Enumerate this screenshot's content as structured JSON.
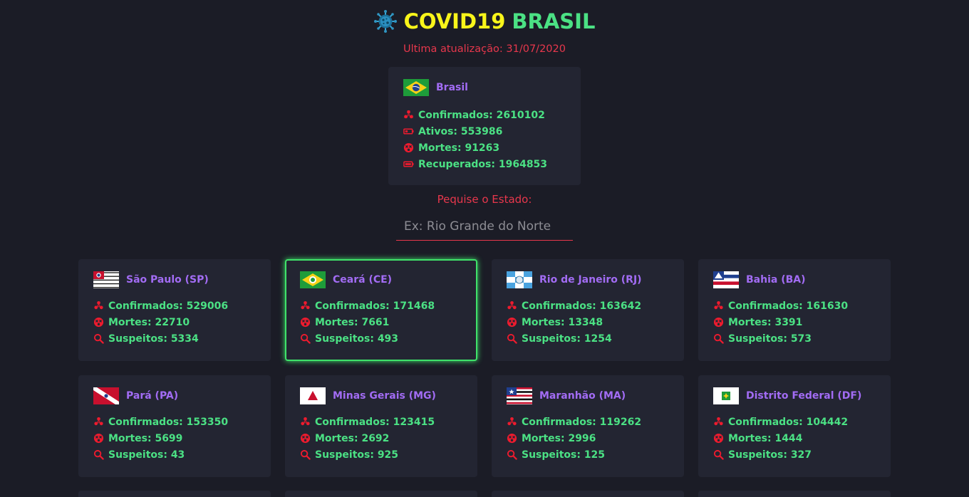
{
  "header": {
    "title_part1": "COVID19",
    "title_part2": "BRASIL",
    "virus_icon": "virus-icon"
  },
  "updated": "Ultima atualização: 31/07/2020",
  "national": {
    "name": "Brasil",
    "confirmed": "Confirmados: 2610102",
    "active": "Ativos: 553986",
    "deaths": "Mortes: 91263",
    "recovered": "Recuperados: 1964853"
  },
  "search": {
    "label": "Pequise o Estado:",
    "placeholder": "Ex: Rio Grande do Norte",
    "value": ""
  },
  "states": [
    {
      "name": "São Paulo (SP)",
      "confirmed": "Confirmados: 529006",
      "deaths": "Mortes: 22710",
      "suspects": "Suspeitos: 5334",
      "selected": false
    },
    {
      "name": "Ceará (CE)",
      "confirmed": "Confirmados: 171468",
      "deaths": "Mortes: 7661",
      "suspects": "Suspeitos: 493",
      "selected": true
    },
    {
      "name": "Rio de Janeiro (RJ)",
      "confirmed": "Confirmados: 163642",
      "deaths": "Mortes: 13348",
      "suspects": "Suspeitos: 1254",
      "selected": false
    },
    {
      "name": "Bahia (BA)",
      "confirmed": "Confirmados: 161630",
      "deaths": "Mortes: 3391",
      "suspects": "Suspeitos: 573",
      "selected": false
    },
    {
      "name": "Pará (PA)",
      "confirmed": "Confirmados: 153350",
      "deaths": "Mortes: 5699",
      "suspects": "Suspeitos: 43",
      "selected": false
    },
    {
      "name": "Minas Gerais (MG)",
      "confirmed": "Confirmados: 123415",
      "deaths": "Mortes: 2692",
      "suspects": "Suspeitos: 925",
      "selected": false
    },
    {
      "name": "Maranhão (MA)",
      "confirmed": "Confirmados: 119262",
      "deaths": "Mortes: 2996",
      "suspects": "Suspeitos: 125",
      "selected": false
    },
    {
      "name": "Distrito Federal (DF)",
      "confirmed": "Confirmados: 104442",
      "deaths": "Mortes: 1444",
      "suspects": "Suspeitos: 327",
      "selected": false
    }
  ],
  "colors": {
    "background": "#1b1c26",
    "card": "#232532",
    "title_yellow": "#f9f51a",
    "title_green": "#4be184",
    "accent_red": "#e8374c",
    "name_purple": "#a26cf4",
    "stat_green": "#4be184",
    "icon_red": "#ee1b2e",
    "selected_border": "#3fe36a"
  },
  "icons": {
    "confirmed": "biohazard-icon",
    "active": "battery-low-icon",
    "deaths": "dizzy-face-icon",
    "recovered": "battery-full-icon",
    "suspects": "search-icon"
  }
}
